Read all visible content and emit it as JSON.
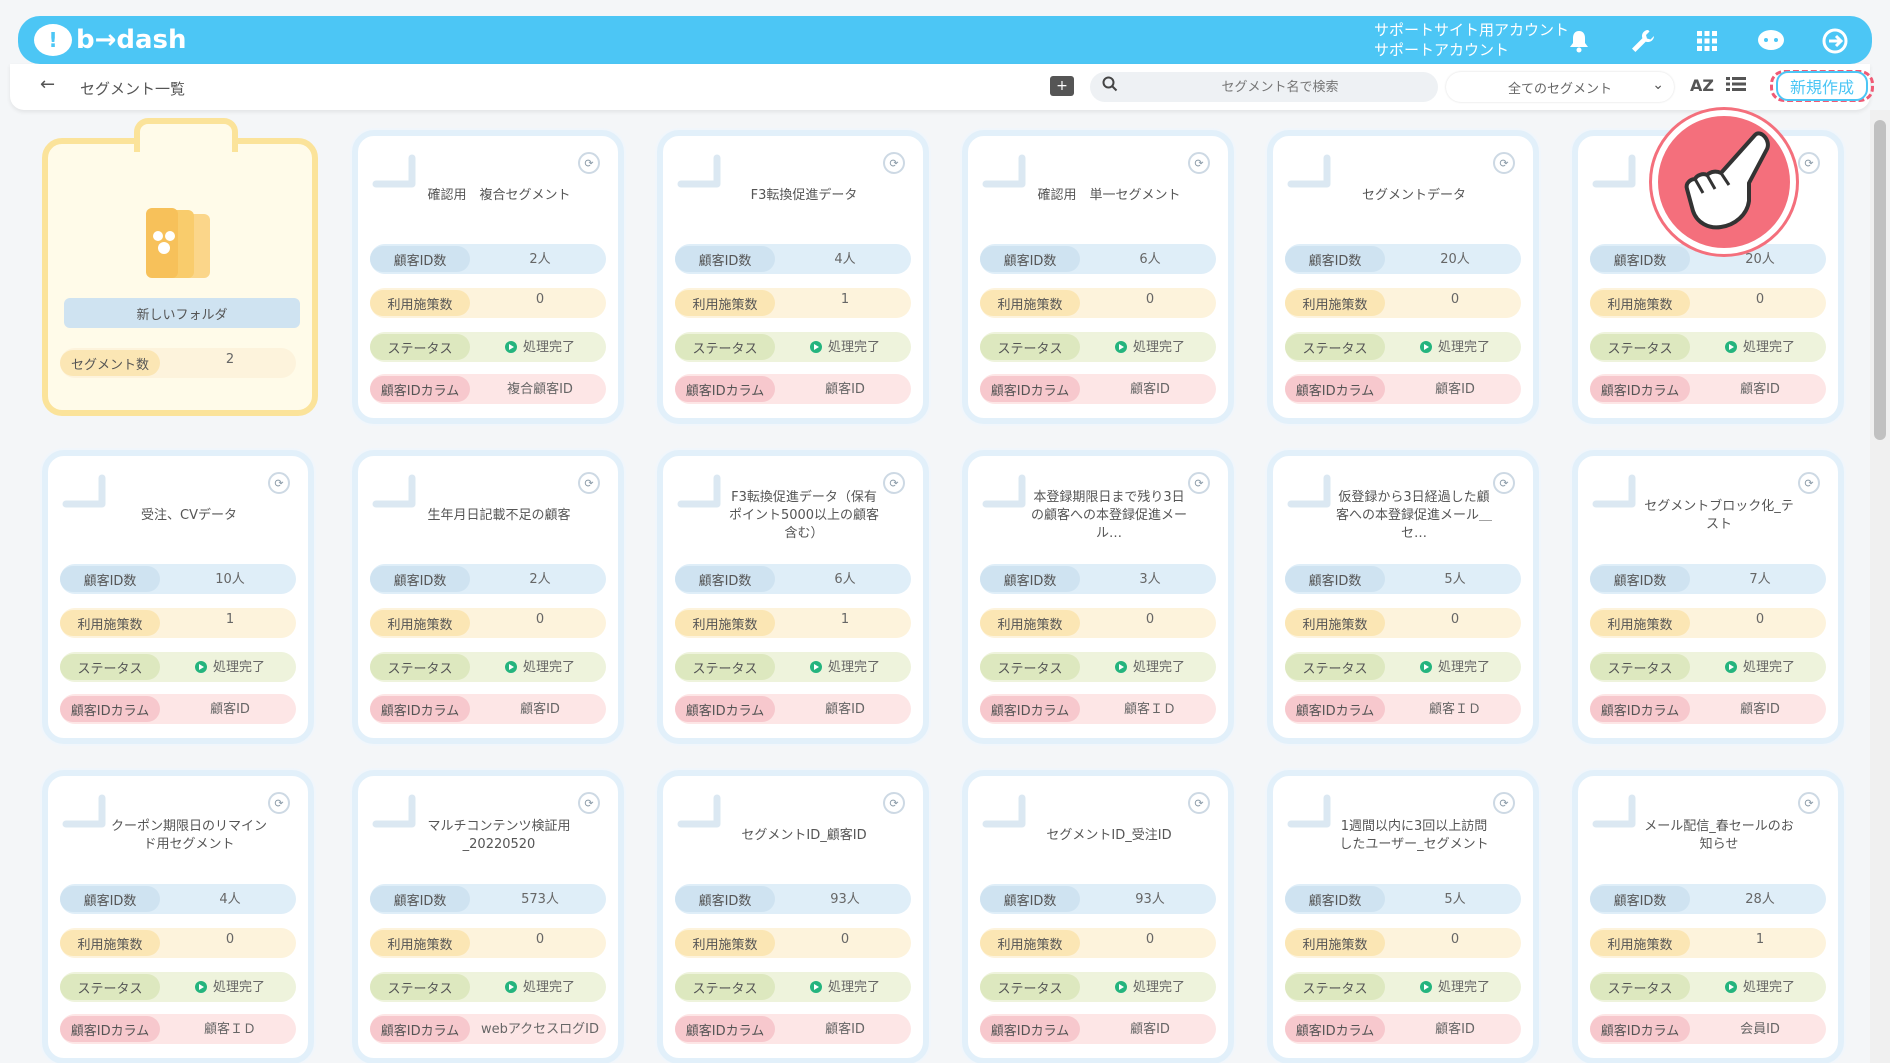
{
  "header": {
    "logo_text": "b→dash",
    "account_line1": "サポートサイト用アカウント",
    "account_line2": "サポートアカウント",
    "icons": [
      "bell-icon",
      "wrench-icon",
      "grid-icon",
      "chat-icon",
      "logout-icon"
    ]
  },
  "toolbar": {
    "back_icon": "←",
    "page_title": "セグメント一覧",
    "search_placeholder": "セグメント名で検索",
    "filter_value": "全てのセグメント",
    "sort_label": "AZ",
    "new_button": "新規作成"
  },
  "folder": {
    "name": "新しいフォルダ",
    "row_label": "セグメント数",
    "row_value": "2"
  },
  "labels": {
    "customers": "顧客ID数",
    "measures": "利用施策数",
    "status": "ステータス",
    "column": "顧客IDカラム"
  },
  "cards": [
    {
      "title": "確認用　複合セグメント",
      "customers": "2人",
      "measures": "0",
      "status": "処理完了",
      "column": "複合顧客ID"
    },
    {
      "title": "F3転換促進データ",
      "customers": "4人",
      "measures": "1",
      "status": "処理完了",
      "column": "顧客ID"
    },
    {
      "title": "確認用　単一セグメント",
      "customers": "6人",
      "measures": "0",
      "status": "処理完了",
      "column": "顧客ID"
    },
    {
      "title": "セグメントデータ",
      "customers": "20人",
      "measures": "0",
      "status": "処理完了",
      "column": "顧客ID"
    },
    {
      "title": "",
      "customers": "20人",
      "measures": "0",
      "status": "処理完了",
      "column": "顧客ID"
    },
    {
      "title": "受注、CVデータ",
      "customers": "10人",
      "measures": "1",
      "status": "処理完了",
      "column": "顧客ID"
    },
    {
      "title": "生年月日記載不足の顧客",
      "customers": "2人",
      "measures": "0",
      "status": "処理完了",
      "column": "顧客ID"
    },
    {
      "title": "F3転換促進データ（保有ポイント5000以上の顧客含む）",
      "customers": "6人",
      "measures": "1",
      "status": "処理完了",
      "column": "顧客ID"
    },
    {
      "title": "本登録期限日まで残り3日の顧客への本登録促進メール…",
      "customers": "3人",
      "measures": "0",
      "status": "処理完了",
      "column": "顧客ＩＤ"
    },
    {
      "title": "仮登録から3日経過した顧客への本登録促進メール＿セ…",
      "customers": "5人",
      "measures": "0",
      "status": "処理完了",
      "column": "顧客ＩＤ"
    },
    {
      "title": "セグメントブロック化_テスト",
      "customers": "7人",
      "measures": "0",
      "status": "処理完了",
      "column": "顧客ID"
    },
    {
      "title": "クーポン期限日のリマインド用セグメント",
      "customers": "4人",
      "measures": "0",
      "status": "処理完了",
      "column": "顧客ＩＤ"
    },
    {
      "title": "マルチコンテンツ検証用_20220520",
      "customers": "573人",
      "measures": "0",
      "status": "処理完了",
      "column": "webアクセスログID"
    },
    {
      "title": "セグメントID_顧客ID",
      "customers": "93人",
      "measures": "0",
      "status": "処理完了",
      "column": "顧客ID"
    },
    {
      "title": "セグメントID_受注ID",
      "customers": "93人",
      "measures": "0",
      "status": "処理完了",
      "column": "顧客ID"
    },
    {
      "title": "1週間以内に3回以上訪問したユーザー_セグメント",
      "customers": "5人",
      "measures": "0",
      "status": "処理完了",
      "column": "顧客ID"
    },
    {
      "title": "メール配信_春セールのお知らせ",
      "customers": "28人",
      "measures": "1",
      "status": "処理完了",
      "column": "会員ID"
    }
  ]
}
